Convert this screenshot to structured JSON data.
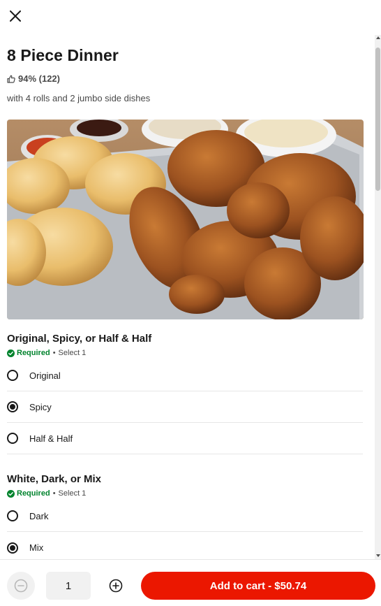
{
  "item": {
    "title": "8 Piece Dinner",
    "rating": "94% (122)",
    "description": "with 4 rolls and 2 jumbo side dishes"
  },
  "groups": [
    {
      "title": "Original, Spicy, or Half & Half",
      "required_label": "Required",
      "dot": "•",
      "select_text": "Select 1",
      "options": [
        {
          "label": "Original",
          "selected": false
        },
        {
          "label": "Spicy",
          "selected": true
        },
        {
          "label": "Half & Half",
          "selected": false
        }
      ]
    },
    {
      "title": "White, Dark, or Mix",
      "required_label": "Required",
      "dot": "•",
      "select_text": "Select 1",
      "options": [
        {
          "label": "Dark",
          "selected": false
        },
        {
          "label": "Mix",
          "selected": true
        }
      ]
    }
  ],
  "footer": {
    "quantity": "1",
    "add_to_cart_label": "Add to cart - $50.74"
  },
  "icons": {
    "close": "close-icon",
    "thumbs_up": "thumbs-up-icon",
    "required_check": "check-circle-icon",
    "minus": "minus-circle-icon",
    "plus": "plus-circle-icon"
  },
  "colors": {
    "accent_red": "#eb1700",
    "required_green": "#00832d",
    "text_primary": "#191919",
    "text_secondary": "#494949"
  }
}
